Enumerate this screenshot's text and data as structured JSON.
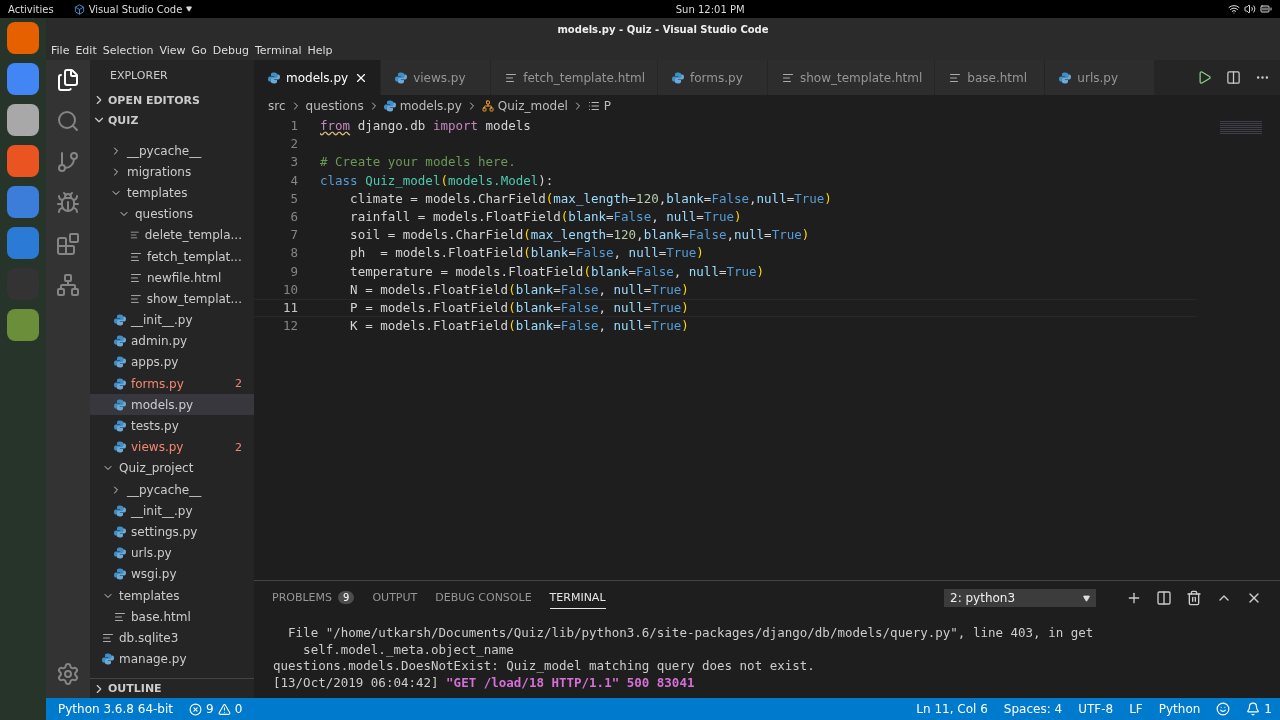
{
  "topbar": {
    "activities": "Activities",
    "app": "Visual Studio Code",
    "clock": "Sun 12:01 PM"
  },
  "window": {
    "title": "models.py - Quiz - Visual Studio Code"
  },
  "menu": [
    "File",
    "Edit",
    "Selection",
    "View",
    "Go",
    "Debug",
    "Terminal",
    "Help"
  ],
  "sidebar": {
    "title": "EXPLORER",
    "sections": [
      {
        "label": "OPEN EDITORS",
        "expanded": false
      },
      {
        "label": "QUIZ",
        "expanded": true
      }
    ],
    "tree": [
      {
        "children": [
          {
            "label": "__pycache__",
            "kind": "folder",
            "expanded": false,
            "selected": false
          },
          {
            "label": "migrations",
            "kind": "folder",
            "expanded": false,
            "selected": false
          },
          {
            "label": "templates",
            "kind": "folder",
            "expanded": true,
            "selected": false,
            "children": [
              {
                "label": "questions",
                "kind": "folder",
                "expanded": true,
                "selected": false,
                "children": [
                  {
                    "label": "delete_templa...",
                    "kind": "text",
                    "selected": false
                  },
                  {
                    "label": "fetch_templat...",
                    "kind": "text",
                    "selected": false
                  },
                  {
                    "label": "newfile.html",
                    "kind": "text",
                    "selected": false
                  },
                  {
                    "label": "show_templat...",
                    "kind": "text",
                    "selected": false
                  }
                ]
              }
            ]
          },
          {
            "label": "__init__.py",
            "kind": "python",
            "selected": false
          },
          {
            "label": "admin.py",
            "kind": "python",
            "selected": false
          },
          {
            "label": "apps.py",
            "kind": "python",
            "selected": false
          },
          {
            "label": "forms.py",
            "kind": "python",
            "selected": false,
            "errors": "2"
          },
          {
            "label": "models.py",
            "kind": "python",
            "selected": true
          },
          {
            "label": "tests.py",
            "kind": "python",
            "selected": false
          },
          {
            "label": "views.py",
            "kind": "python",
            "selected": false,
            "errors": "2"
          }
        ]
      },
      {
        "label": "Quiz_project",
        "kind": "folder",
        "expanded": true,
        "selected": false,
        "children": [
          {
            "label": "__pycache__",
            "kind": "folder",
            "expanded": false,
            "selected": false
          },
          {
            "label": "__init__.py",
            "kind": "python",
            "selected": false
          },
          {
            "label": "settings.py",
            "kind": "python",
            "selected": false
          },
          {
            "label": "urls.py",
            "kind": "python",
            "selected": false
          },
          {
            "label": "wsgi.py",
            "kind": "python",
            "selected": false
          }
        ]
      },
      {
        "label": "templates",
        "kind": "folder",
        "expanded": true,
        "selected": false,
        "children": [
          {
            "label": "base.html",
            "kind": "text",
            "selected": false
          }
        ]
      },
      {
        "label": "db.sqlite3",
        "kind": "text",
        "selected": false
      },
      {
        "label": "manage.py",
        "kind": "python",
        "selected": false
      }
    ],
    "outline": {
      "label": "OUTLINE",
      "expanded": false
    }
  },
  "tabs": [
    {
      "label": "models.py",
      "kind": "python",
      "selected": true
    },
    {
      "label": "views.py",
      "kind": "python",
      "selected": false
    },
    {
      "label": "fetch_template.html",
      "kind": "text",
      "selected": false
    },
    {
      "label": "forms.py",
      "kind": "python",
      "selected": false
    },
    {
      "label": "show_template.html",
      "kind": "text",
      "selected": false
    },
    {
      "label": "base.html",
      "kind": "text",
      "selected": false
    },
    {
      "label": "urls.py",
      "kind": "python",
      "selected": false
    }
  ],
  "breadcrumb": [
    {
      "label": "src",
      "kind": "folder"
    },
    {
      "label": "questions",
      "kind": "folder"
    },
    {
      "label": "models.py",
      "kind": "python"
    },
    {
      "label": "Quiz_model",
      "kind": "class"
    },
    {
      "label": "P",
      "kind": "field"
    }
  ],
  "code": [
    {
      "number": "1",
      "current": false,
      "tokens": [
        {
          "text": "from",
          "kind": "keyword",
          "squiggle": true
        },
        {
          "text": " django.db ",
          "kind": "plain"
        },
        {
          "text": "import",
          "kind": "keyword"
        },
        {
          "text": " models",
          "kind": "plain"
        }
      ]
    },
    {
      "number": "2",
      "current": false
    },
    {
      "number": "3",
      "current": false,
      "tokens": [
        {
          "text": "# Create your models here.",
          "kind": "comment"
        }
      ]
    },
    {
      "number": "4",
      "current": false,
      "tokens": [
        {
          "text": "class ",
          "kind": "storage"
        },
        {
          "text": "Quiz_model",
          "kind": "type"
        },
        {
          "text": "(",
          "kind": "paren"
        },
        {
          "text": "models.Model",
          "kind": "type"
        },
        {
          "text": "):",
          "kind": "plain"
        }
      ]
    },
    {
      "number": "5",
      "current": false,
      "tokens": [
        {
          "text": "    climate = models.CharField",
          "kind": "plain"
        },
        {
          "text": "(",
          "kind": "paren"
        },
        {
          "text": "max_length",
          "kind": "param"
        },
        {
          "text": "=",
          "kind": "plain"
        },
        {
          "text": "120",
          "kind": "number"
        },
        {
          "text": ",",
          "kind": "plain"
        },
        {
          "text": "blank",
          "kind": "param"
        },
        {
          "text": "=",
          "kind": "plain"
        },
        {
          "text": "False",
          "kind": "constant"
        },
        {
          "text": ",",
          "kind": "plain"
        },
        {
          "text": "null",
          "kind": "param"
        },
        {
          "text": "=",
          "kind": "plain"
        },
        {
          "text": "True",
          "kind": "constant"
        },
        {
          "text": ")",
          "kind": "paren"
        }
      ]
    },
    {
      "number": "6",
      "current": false,
      "tokens": [
        {
          "text": "    rainfall = models.FloatField",
          "kind": "plain"
        },
        {
          "text": "(",
          "kind": "paren"
        },
        {
          "text": "blank",
          "kind": "param"
        },
        {
          "text": "=",
          "kind": "plain"
        },
        {
          "text": "False",
          "kind": "constant"
        },
        {
          "text": ", ",
          "kind": "plain"
        },
        {
          "text": "null",
          "kind": "param"
        },
        {
          "text": "=",
          "kind": "plain"
        },
        {
          "text": "True",
          "kind": "constant"
        },
        {
          "text": ")",
          "kind": "paren"
        }
      ]
    },
    {
      "number": "7",
      "current": false,
      "tokens": [
        {
          "text": "    soil = models.CharField",
          "kind": "plain"
        },
        {
          "text": "(",
          "kind": "paren"
        },
        {
          "text": "max_length",
          "kind": "param"
        },
        {
          "text": "=",
          "kind": "plain"
        },
        {
          "text": "120",
          "kind": "number"
        },
        {
          "text": ",",
          "kind": "plain"
        },
        {
          "text": "blank",
          "kind": "param"
        },
        {
          "text": "=",
          "kind": "plain"
        },
        {
          "text": "False",
          "kind": "constant"
        },
        {
          "text": ",",
          "kind": "plain"
        },
        {
          "text": "null",
          "kind": "param"
        },
        {
          "text": "=",
          "kind": "plain"
        },
        {
          "text": "True",
          "kind": "constant"
        },
        {
          "text": ")",
          "kind": "paren"
        }
      ]
    },
    {
      "number": "8",
      "current": false,
      "tokens": [
        {
          "text": "    ph  = models.FloatField",
          "kind": "plain"
        },
        {
          "text": "(",
          "kind": "paren"
        },
        {
          "text": "blank",
          "kind": "param"
        },
        {
          "text": "=",
          "kind": "plain"
        },
        {
          "text": "False",
          "kind": "constant"
        },
        {
          "text": ", ",
          "kind": "plain"
        },
        {
          "text": "null",
          "kind": "param"
        },
        {
          "text": "=",
          "kind": "plain"
        },
        {
          "text": "True",
          "kind": "constant"
        },
        {
          "text": ")",
          "kind": "paren"
        }
      ]
    },
    {
      "number": "9",
      "current": false,
      "tokens": [
        {
          "text": "    temperature = models.FloatField",
          "kind": "plain"
        },
        {
          "text": "(",
          "kind": "paren"
        },
        {
          "text": "blank",
          "kind": "param"
        },
        {
          "text": "=",
          "kind": "plain"
        },
        {
          "text": "False",
          "kind": "constant"
        },
        {
          "text": ", ",
          "kind": "plain"
        },
        {
          "text": "null",
          "kind": "param"
        },
        {
          "text": "=",
          "kind": "plain"
        },
        {
          "text": "True",
          "kind": "constant"
        },
        {
          "text": ")",
          "kind": "paren"
        }
      ]
    },
    {
      "number": "10",
      "current": false,
      "tokens": [
        {
          "text": "    N = models.FloatField",
          "kind": "plain"
        },
        {
          "text": "(",
          "kind": "paren"
        },
        {
          "text": "blank",
          "kind": "param"
        },
        {
          "text": "=",
          "kind": "plain"
        },
        {
          "text": "False",
          "kind": "constant"
        },
        {
          "text": ", ",
          "kind": "plain"
        },
        {
          "text": "null",
          "kind": "param"
        },
        {
          "text": "=",
          "kind": "plain"
        },
        {
          "text": "True",
          "kind": "constant"
        },
        {
          "text": ")",
          "kind": "paren"
        }
      ]
    },
    {
      "number": "11",
      "current": true,
      "tokens": [
        {
          "text": "    P = models.FloatField",
          "kind": "plain"
        },
        {
          "text": "(",
          "kind": "paren"
        },
        {
          "text": "blank",
          "kind": "param"
        },
        {
          "text": "=",
          "kind": "plain"
        },
        {
          "text": "False",
          "kind": "constant"
        },
        {
          "text": ", ",
          "kind": "plain"
        },
        {
          "text": "null",
          "kind": "param"
        },
        {
          "text": "=",
          "kind": "plain"
        },
        {
          "text": "True",
          "kind": "constant"
        },
        {
          "text": ")",
          "kind": "paren"
        }
      ]
    },
    {
      "number": "12",
      "current": false,
      "tokens": [
        {
          "text": "    K = models.FloatField",
          "kind": "plain"
        },
        {
          "text": "(",
          "kind": "paren"
        },
        {
          "text": "blank",
          "kind": "param"
        },
        {
          "text": "=",
          "kind": "plain"
        },
        {
          "text": "False",
          "kind": "constant"
        },
        {
          "text": ", ",
          "kind": "plain"
        },
        {
          "text": "null",
          "kind": "param"
        },
        {
          "text": "=",
          "kind": "plain"
        },
        {
          "text": "True",
          "kind": "constant"
        },
        {
          "text": ")",
          "kind": "paren"
        }
      ]
    }
  ],
  "panel": {
    "tabs": [
      {
        "label": "PROBLEMS",
        "badge": "9",
        "selected": false
      },
      {
        "label": "OUTPUT",
        "selected": false
      },
      {
        "label": "DEBUG CONSOLE",
        "selected": false
      },
      {
        "label": "TERMINAL",
        "selected": true
      }
    ],
    "terminal_select": "2: python3",
    "terminal": [
      {
        "text": "  File \"/home/utkarsh/Documents/Quiz/lib/python3.6/site-packages/django/db/models/query.py\", line 403, in get"
      },
      {
        "text": "    self.model._meta.object_name"
      },
      {
        "text": "questions.models.DoesNotExist: Quiz_model matching query does not exist."
      },
      {
        "text": "[13/Oct/2019 06:04:42] ",
        "request": "\"GET /load/18 HTTP/1.1\" 500 83041"
      }
    ]
  },
  "status": {
    "interpreter": "Python 3.6.8 64-bit",
    "errors": "9",
    "warnings": "0",
    "position": "Ln 11, Col 6",
    "spaces": "Spaces: 4",
    "encoding": "UTF-8",
    "eol": "LF",
    "language": "Python",
    "notifications": "1"
  }
}
